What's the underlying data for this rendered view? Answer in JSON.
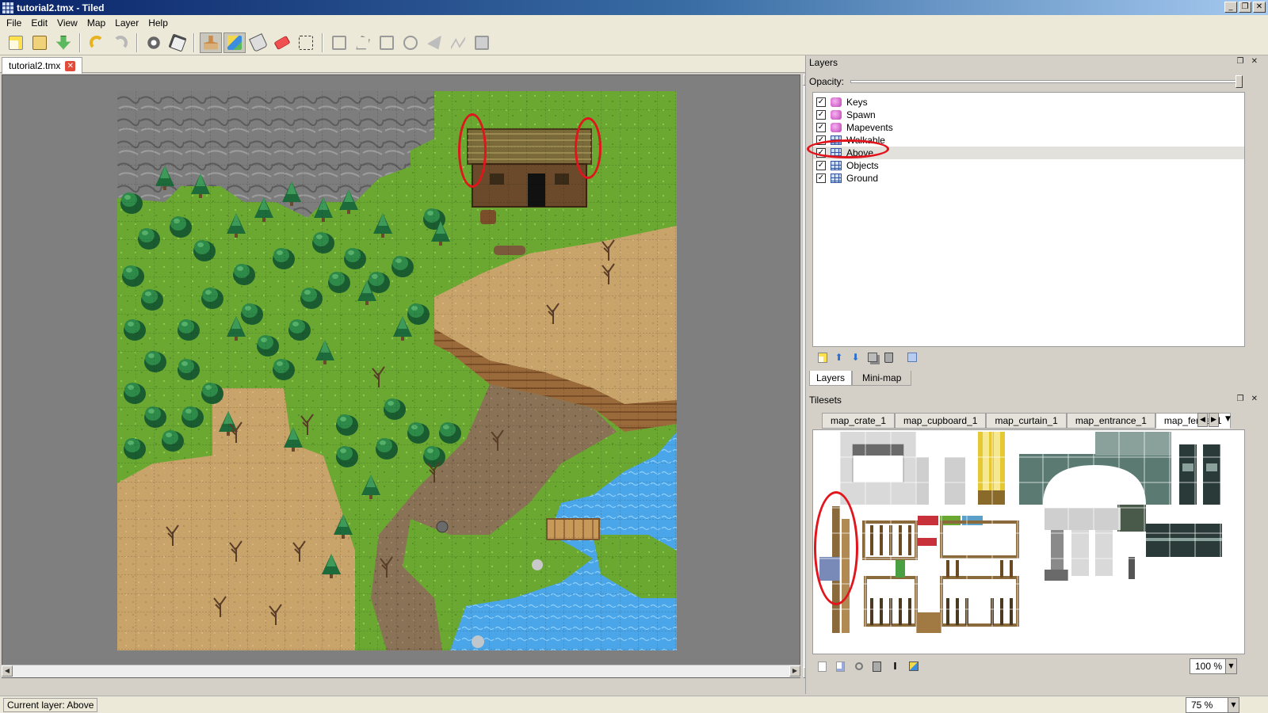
{
  "window": {
    "title": "tutorial2.tmx - Tiled",
    "controls": [
      "_",
      "❐",
      "✕"
    ]
  },
  "menu": [
    "File",
    "Edit",
    "View",
    "Map",
    "Layer",
    "Help"
  ],
  "document_tab": {
    "label": "tutorial2.tmx",
    "close_glyph": "✕"
  },
  "layers_panel": {
    "title": "Layers",
    "dock_controls": "❐ ✕",
    "opacity_label": "Opacity:",
    "opacity": 1.0,
    "layers": [
      {
        "name": "Keys",
        "type": "object",
        "visible": true,
        "selected": false
      },
      {
        "name": "Spawn",
        "type": "object",
        "visible": true,
        "selected": false
      },
      {
        "name": "Mapevents",
        "type": "object",
        "visible": true,
        "selected": false
      },
      {
        "name": "Walkable",
        "type": "tile",
        "visible": true,
        "selected": false
      },
      {
        "name": "Above",
        "type": "tile",
        "visible": true,
        "selected": true
      },
      {
        "name": "Objects",
        "type": "tile",
        "visible": true,
        "selected": false
      },
      {
        "name": "Ground",
        "type": "tile",
        "visible": true,
        "selected": false
      }
    ],
    "tabs": [
      "Layers",
      "Mini-map"
    ]
  },
  "tilesets_panel": {
    "title": "Tilesets",
    "dock_controls": "❐ ✕",
    "tabs": [
      "map_crate_1",
      "map_cupboard_1",
      "map_curtain_1",
      "map_entrance_1",
      "map_fence_1"
    ],
    "active_tab": "map_fence_1",
    "zoom": "100 %"
  },
  "map_zoom": "75 %",
  "status": {
    "current_layer": "Current layer: Above"
  },
  "colors": {
    "grass": "#6aa832",
    "dirt": "#c9a46a",
    "rock": "#8a8a8a",
    "water": "#4aa6e8",
    "tree": "#1f6d3a",
    "highlight": "#e2141c"
  }
}
